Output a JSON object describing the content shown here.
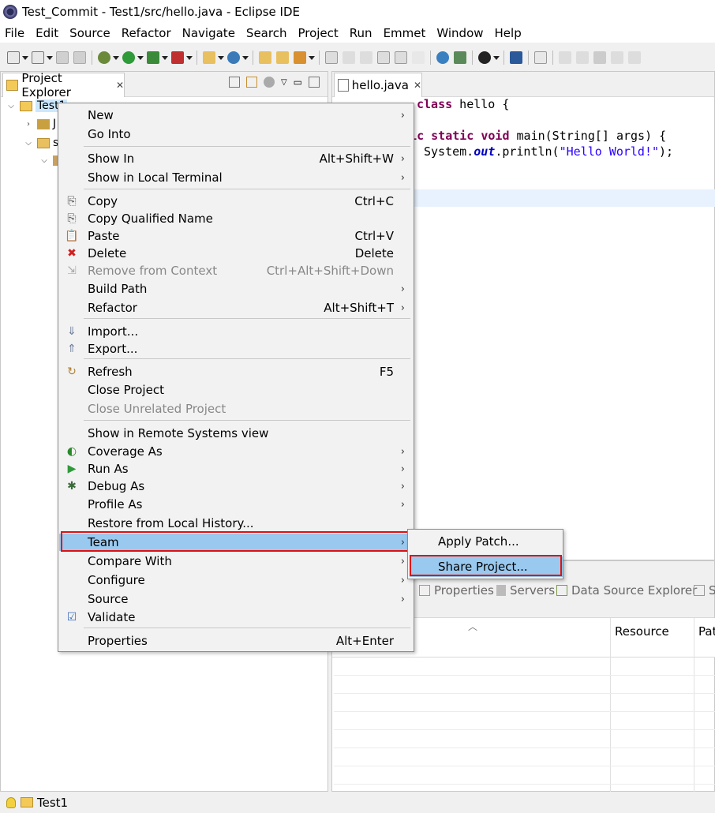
{
  "window": {
    "title": "Test_Commit - Test1/src/hello.java - Eclipse IDE"
  },
  "menubar": {
    "items": [
      "File",
      "Edit",
      "Source",
      "Refactor",
      "Navigate",
      "Search",
      "Project",
      "Run",
      "Emmet",
      "Window",
      "Help"
    ]
  },
  "project_explorer": {
    "tab_label": "Project Explorer",
    "tree": [
      {
        "label": "Test1"
      },
      {
        "label": "J"
      },
      {
        "label": "s"
      },
      {
        "label": ""
      }
    ]
  },
  "editor": {
    "tab_label": "hello.java",
    "code_lines": [
      {
        "kw": "class",
        "text": " hello {"
      },
      {
        "kw": "blic static void",
        "text": " main(String[] args) {"
      },
      {
        "pre": "System.",
        "fld": "out",
        "mid": ".println(",
        "str": "\"Hello World!\"",
        "post": ");"
      }
    ]
  },
  "bottom_panel": {
    "tabs": [
      "Properties",
      "Servers",
      "Data Source Explorer",
      "S"
    ],
    "columns": [
      "Resource",
      "Pat"
    ]
  },
  "context_menu": {
    "items": [
      {
        "label": "New",
        "shortcut": "",
        "submenu": true,
        "disabled": false,
        "icon": ""
      },
      {
        "label": "Go Into",
        "shortcut": "",
        "submenu": false,
        "disabled": false,
        "icon": ""
      },
      {
        "label": "Show In",
        "shortcut": "Alt+Shift+W",
        "submenu": true,
        "disabled": false,
        "icon": ""
      },
      {
        "label": "Show in Local Terminal",
        "shortcut": "",
        "submenu": true,
        "disabled": false,
        "icon": ""
      },
      {
        "label": "Copy",
        "shortcut": "Ctrl+C",
        "submenu": false,
        "disabled": false,
        "icon": "copy-icon"
      },
      {
        "label": "Copy Qualified Name",
        "shortcut": "",
        "submenu": false,
        "disabled": false,
        "icon": "copy-qualified-icon"
      },
      {
        "label": "Paste",
        "shortcut": "Ctrl+V",
        "submenu": false,
        "disabled": false,
        "icon": "paste-icon"
      },
      {
        "label": "Delete",
        "shortcut": "Delete",
        "submenu": false,
        "disabled": false,
        "icon": "delete-icon"
      },
      {
        "label": "Remove from Context",
        "shortcut": "Ctrl+Alt+Shift+Down",
        "submenu": false,
        "disabled": true,
        "icon": "remove-context-icon"
      },
      {
        "label": "Build Path",
        "shortcut": "",
        "submenu": true,
        "disabled": false,
        "icon": ""
      },
      {
        "label": "Refactor",
        "shortcut": "Alt+Shift+T",
        "submenu": true,
        "disabled": false,
        "icon": ""
      },
      {
        "label": "Import...",
        "shortcut": "",
        "submenu": false,
        "disabled": false,
        "icon": "import-icon"
      },
      {
        "label": "Export...",
        "shortcut": "",
        "submenu": false,
        "disabled": false,
        "icon": "export-icon"
      },
      {
        "label": "Refresh",
        "shortcut": "F5",
        "submenu": false,
        "disabled": false,
        "icon": "refresh-icon"
      },
      {
        "label": "Close Project",
        "shortcut": "",
        "submenu": false,
        "disabled": false,
        "icon": ""
      },
      {
        "label": "Close Unrelated Project",
        "shortcut": "",
        "submenu": false,
        "disabled": true,
        "icon": ""
      },
      {
        "label": "Show in Remote Systems view",
        "shortcut": "",
        "submenu": false,
        "disabled": false,
        "icon": ""
      },
      {
        "label": "Coverage As",
        "shortcut": "",
        "submenu": true,
        "disabled": false,
        "icon": "coverage-icon"
      },
      {
        "label": "Run As",
        "shortcut": "",
        "submenu": true,
        "disabled": false,
        "icon": "run-icon"
      },
      {
        "label": "Debug As",
        "shortcut": "",
        "submenu": true,
        "disabled": false,
        "icon": "debug-icon"
      },
      {
        "label": "Profile As",
        "shortcut": "",
        "submenu": true,
        "disabled": false,
        "icon": ""
      },
      {
        "label": "Restore from Local History...",
        "shortcut": "",
        "submenu": false,
        "disabled": false,
        "icon": ""
      },
      {
        "label": "Team",
        "shortcut": "",
        "submenu": true,
        "disabled": false,
        "icon": "",
        "selected": true
      },
      {
        "label": "Compare With",
        "shortcut": "",
        "submenu": true,
        "disabled": false,
        "icon": ""
      },
      {
        "label": "Configure",
        "shortcut": "",
        "submenu": true,
        "disabled": false,
        "icon": ""
      },
      {
        "label": "Source",
        "shortcut": "",
        "submenu": true,
        "disabled": false,
        "icon": ""
      },
      {
        "label": "Validate",
        "shortcut": "",
        "submenu": false,
        "disabled": false,
        "icon": "check-icon"
      },
      {
        "label": "Properties",
        "shortcut": "Alt+Enter",
        "submenu": false,
        "disabled": false,
        "icon": ""
      }
    ]
  },
  "team_submenu": {
    "items": [
      {
        "label": "Apply Patch...",
        "selected": false
      },
      {
        "label": "Share Project...",
        "selected": true
      }
    ]
  },
  "statusbar": {
    "label": "Test1"
  },
  "colors": {
    "selection": "#99c9ef",
    "highlight_outline": "#e01010",
    "keyword": "#7f0055",
    "string": "#2a00ff"
  }
}
